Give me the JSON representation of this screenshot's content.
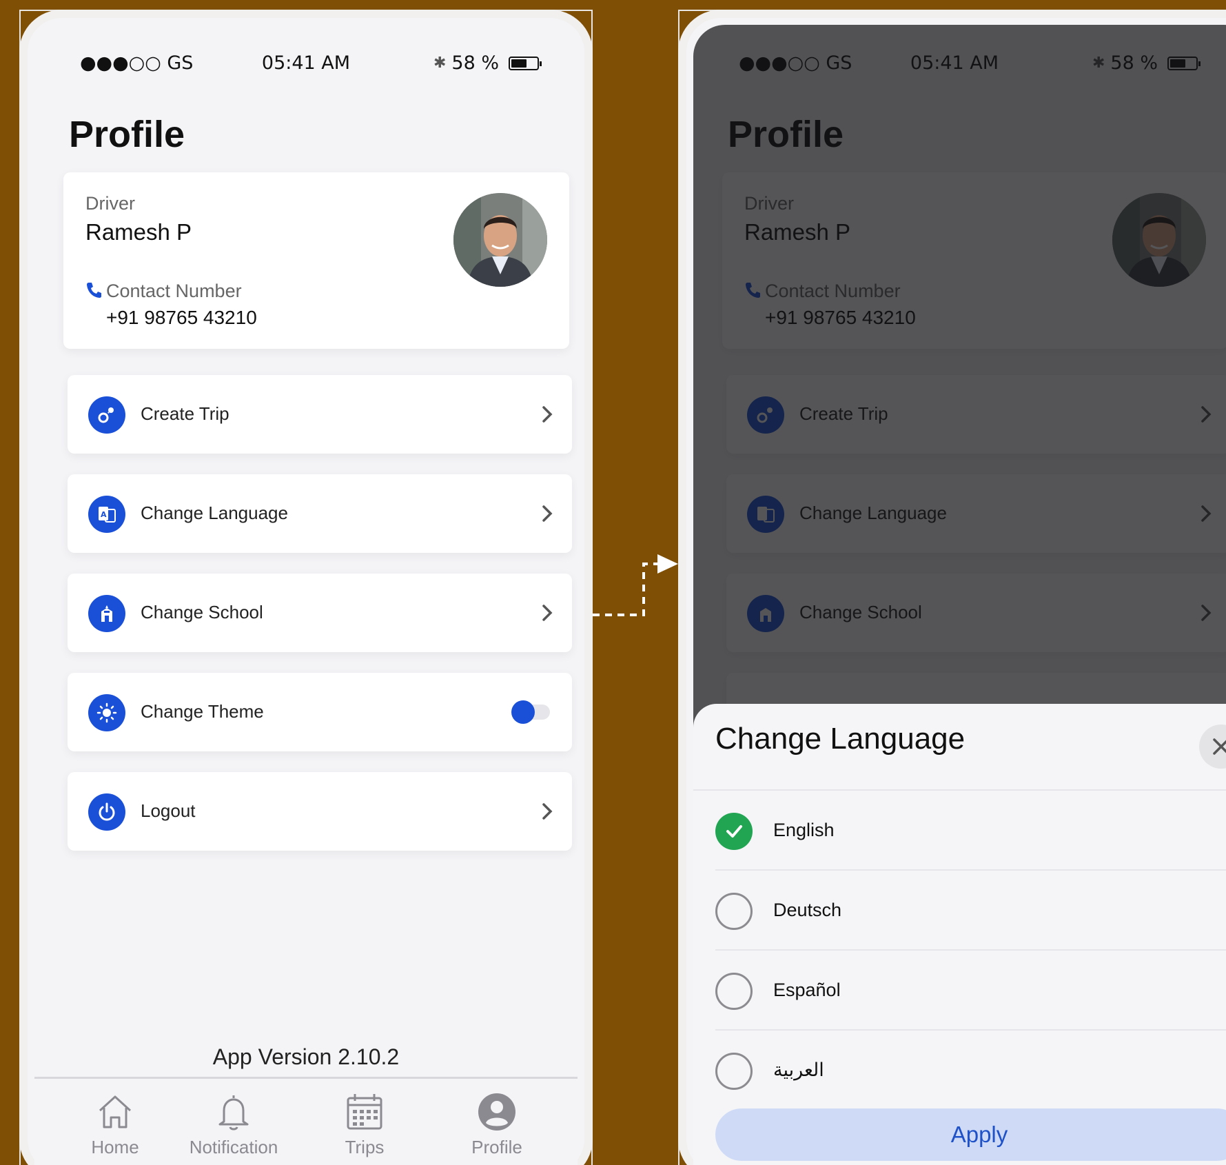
{
  "colors": {
    "background": "#7f4f06",
    "accent": "#1a50d8",
    "success": "#21a553",
    "apply_bg": "#cfdbf6"
  },
  "status_bar": {
    "carrier": "●●●○○ GS",
    "time": "05:41 AM",
    "battery": "58 %"
  },
  "page_title": "Profile",
  "profile": {
    "role": "Driver",
    "name": "Ramesh P",
    "contact_label": "Contact Number",
    "contact_value": "+91 98765 43210"
  },
  "menu": {
    "items": [
      {
        "label": "Create Trip",
        "icon": "route-pin-icon"
      },
      {
        "label": "Change Language",
        "icon": "translate-icon"
      },
      {
        "label": "Change School",
        "icon": "school-icon"
      },
      {
        "label": "Change Theme",
        "icon": "sun-icon",
        "toggle_on": true
      },
      {
        "label": "Logout",
        "icon": "power-icon"
      }
    ]
  },
  "app_version": "App Version 2.10.2",
  "tabs": [
    {
      "label": "Home",
      "icon": "home-icon"
    },
    {
      "label": "Notification",
      "icon": "bell-icon"
    },
    {
      "label": "Trips",
      "icon": "calendar-icon"
    },
    {
      "label": "Profile",
      "icon": "user-icon"
    }
  ],
  "language_sheet": {
    "title": "Change Language",
    "options": [
      {
        "label": "English",
        "selected": true
      },
      {
        "label": "Deutsch",
        "selected": false
      },
      {
        "label": "Español",
        "selected": false
      },
      {
        "label": "العربية",
        "selected": false
      }
    ],
    "apply_label": "Apply"
  }
}
